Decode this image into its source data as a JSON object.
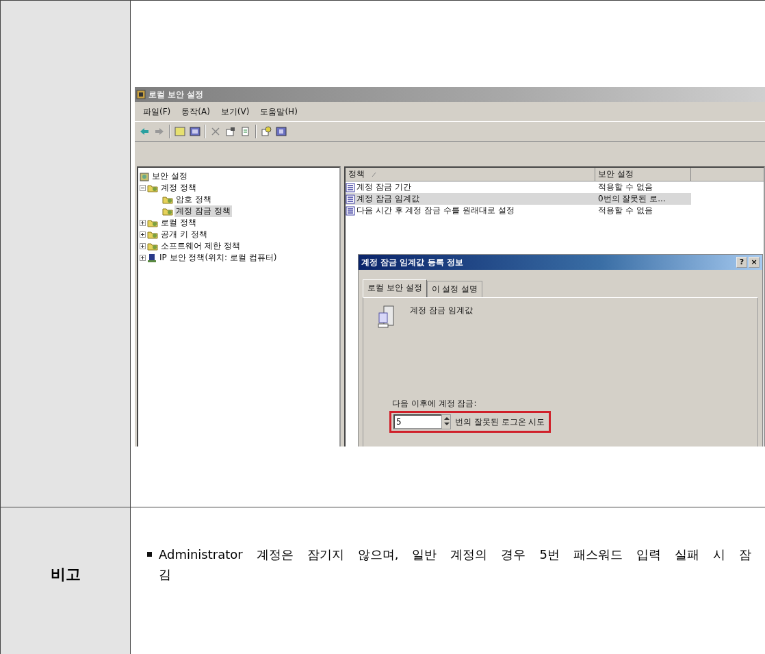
{
  "document_table": {
    "screenshot_row": {
      "window": {
        "title": "로컬 보안 설정",
        "menu": [
          "파일(F)",
          "동작(A)",
          "보기(V)",
          "도움말(H)"
        ],
        "tree": [
          {
            "label": "보안 설정",
            "kind": "root",
            "selected": false,
            "children": [
              {
                "label": "계정 정책",
                "kind": "folder",
                "expanded": true,
                "selected": false,
                "children": [
                  {
                    "label": "암호 정책",
                    "kind": "folder",
                    "selected": false
                  },
                  {
                    "label": "계정 잠금 정책",
                    "kind": "folder",
                    "selected": true
                  }
                ]
              },
              {
                "label": "로컬 정책",
                "kind": "folder",
                "expanded": false,
                "selected": false
              },
              {
                "label": "공개 키 정책",
                "kind": "folder",
                "expanded": false,
                "selected": false
              },
              {
                "label": "소프트웨어 제한 정책",
                "kind": "folder",
                "expanded": false,
                "selected": false
              },
              {
                "label": "IP 보안 정책(위치: 로컬 컴퓨터)",
                "kind": "network",
                "expanded": false,
                "selected": false
              }
            ]
          }
        ],
        "list": {
          "columns": [
            "정책",
            "보안 설정"
          ],
          "rows": [
            {
              "policy": "계정 잠금 기간",
              "setting": "적용할 수 없음",
              "selected": false
            },
            {
              "policy": "계정 잠금 임계값",
              "setting": "0번의 잘못된 로...",
              "selected": true
            },
            {
              "policy": "다음 시간 후 계정 잠금 수를 원래대로 설정",
              "setting": "적용할 수 없음",
              "selected": false
            }
          ]
        },
        "dialog": {
          "title": "계정 잠금 임계값 등록 정보",
          "help": "?",
          "close": "×",
          "tabs": [
            {
              "label": "로컬 보안 설정",
              "selected": true
            },
            {
              "label": "이 설정 설명",
              "selected": false
            }
          ],
          "heading": "계정 잠금 임계값",
          "field_label": "다음 이후에 계정 잠금:",
          "value": "5",
          "suffix": "번의 잘못된 로그온 시도",
          "highlighted": true
        }
      }
    },
    "remarks_row": {
      "header": "비고",
      "bullets": [
        "Administrator 계정은 잠기지 않으며, 일반 계정의 경우 5번 패스워드 입력 실패 시 잠김"
      ]
    }
  }
}
